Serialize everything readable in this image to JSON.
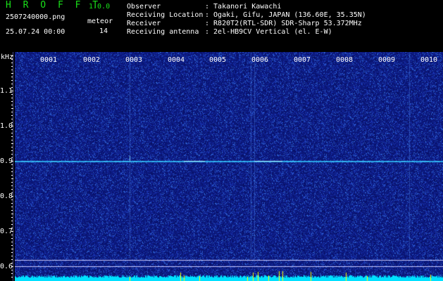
{
  "header": {
    "app_title": "H R O F F T",
    "app_version": "1.0.0",
    "file_name": "2507240000.png",
    "meteor_label": "meteor",
    "date_time": "25.07.24 00:00",
    "meteor_count": "14"
  },
  "info": [
    {
      "key": "Observer",
      "value": ": Takanori Kawachi"
    },
    {
      "key": "Receiving Location",
      "value": ": Ogaki, Gifu, JAPAN (136.60E, 35.35N)"
    },
    {
      "key": "Receiver",
      "value": ": R820T2(RTL-SDR) SDR-Sharp 53.372MHz"
    },
    {
      "key": "Receiving antenna",
      "value": ": 2el-HB9CV Vertical (el. E-W)"
    }
  ],
  "spectrogram": {
    "y_unit": "kHz",
    "y_labels": [
      "1.1",
      "1.0",
      "0.9",
      "0.8",
      "0.7",
      "0.6"
    ],
    "x_labels": [
      "0001",
      "0002",
      "0003",
      "0004",
      "0005",
      "0006",
      "0007",
      "0008",
      "0009",
      "0010"
    ],
    "carrier_khz": 0.9,
    "colors": {
      "background": "#0d1c86",
      "signal": "#3fc8ff",
      "level": "#00e0ff",
      "peak": "#ffff00",
      "text": "#ffffff",
      "title": "#19e019"
    }
  }
}
